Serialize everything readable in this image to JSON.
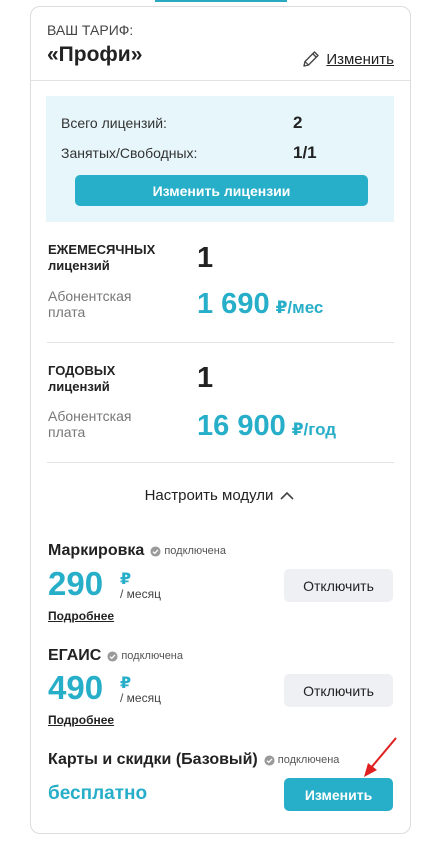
{
  "tariff": {
    "label": "ВАШ ТАРИФ:",
    "name": "«Профи»",
    "change_label": "Изменить"
  },
  "licenses": {
    "total_label": "Всего лицензий:",
    "total_value": "2",
    "used_label": "Занятых/Свободных:",
    "used_value": "1/1",
    "change_button": "Изменить лицензии"
  },
  "monthly": {
    "title_line1": "ЕЖЕМЕСЯЧНЫХ",
    "title_line2": "лицензий",
    "count": "1",
    "fee_line1": "Абонентская",
    "fee_line2": "плата",
    "price": "1 690",
    "unit": "₽/мес"
  },
  "yearly": {
    "title_line1": "ГОДОВЫХ",
    "title_line2": "лицензий",
    "count": "1",
    "fee_line1": "Абонентская",
    "fee_line2": "плата",
    "price": "16 900",
    "unit": "₽/год"
  },
  "modules": {
    "toggle_label": "Настроить модули",
    "items": [
      {
        "name": "Маркировка",
        "status": "подключена",
        "price": "290",
        "currency": "₽",
        "period": "/ месяц",
        "more": "Подробнее",
        "action": "Отключить"
      },
      {
        "name": "ЕГАИС",
        "status": "подключена",
        "price": "490",
        "currency": "₽",
        "period": "/ месяц",
        "more": "Подробнее",
        "action": "Отключить"
      },
      {
        "name": "Карты и скидки (Базовый)",
        "status": "подключена",
        "price": "бесплатно",
        "action": "Изменить"
      }
    ]
  },
  "colors": {
    "accent": "#27aec8",
    "license_bg": "#e6f6fb",
    "annotation_arrow": "#e02020"
  }
}
